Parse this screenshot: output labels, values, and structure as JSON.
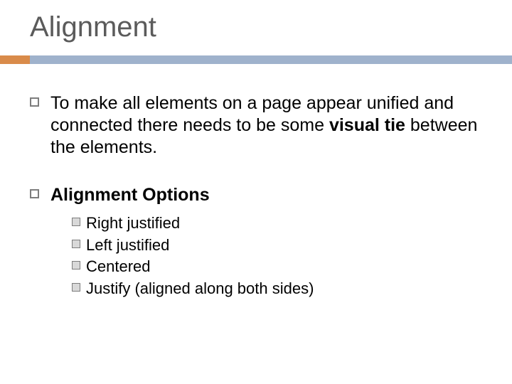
{
  "title": "Alignment",
  "bullets": [
    {
      "segments": [
        {
          "text": "To make all elements on a page appear unified and connected there needs to be some ",
          "bold": false
        },
        {
          "text": "visual tie",
          "bold": true
        },
        {
          "text": " between the elements.",
          "bold": false
        }
      ]
    },
    {
      "segments": [
        {
          "text": "Alignment Options",
          "bold": true
        }
      ],
      "subitems": [
        "Right justified",
        "Left justified",
        "Centered",
        "Justify (aligned along both sides)"
      ]
    }
  ]
}
